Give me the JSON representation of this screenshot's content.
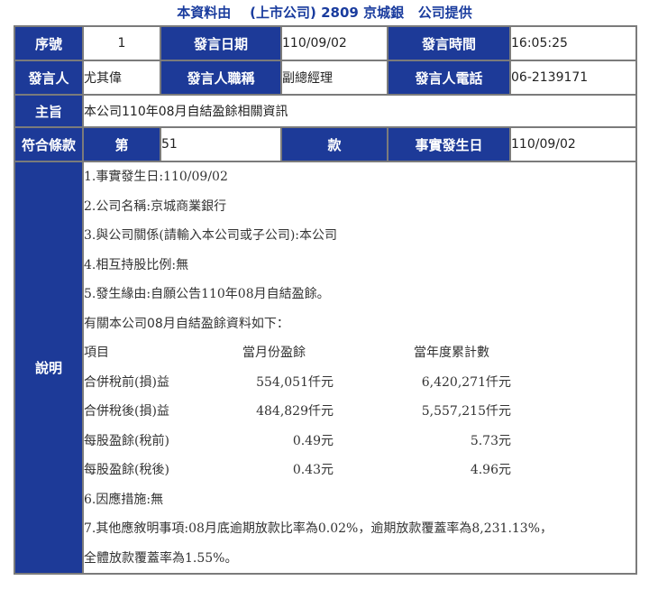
{
  "header": {
    "prefix": "本資料由",
    "company_type": "(上市公司)",
    "code": "2809",
    "company": "京城銀",
    "suffix": "公司提供"
  },
  "rows": {
    "seq_label": "序號",
    "seq_value": "1",
    "date_label": "發言日期",
    "date_value": "110/09/02",
    "time_label": "發言時間",
    "time_value": "16:05:25",
    "speaker_label": "發言人",
    "speaker_value": "尤其偉",
    "title_label": "發言人職稱",
    "title_value": "副總經理",
    "phone_label": "發言人電話",
    "phone_value": "06-2139171",
    "subject_label": "主旨",
    "subject_value": "本公司110年08月自結盈餘相關資訊",
    "clause_label": "符合條款",
    "clause_di": "第",
    "clause_value": "51",
    "clause_kuan": "款",
    "fact_date_label": "事實發生日",
    "fact_date_value": "110/09/02",
    "desc_label": "說明"
  },
  "description": {
    "l1": "1.事實發生日:110/09/02",
    "l2": "2.公司名稱:京城商業銀行",
    "l3": "3.與公司關係(請輸入本公司或子公司):本公司",
    "l4": "4.相互持股比例:無",
    "l5": "5.發生緣由:自願公告110年08月自結盈餘。",
    "intro": "有關本公司08月自結盈餘資料如下：",
    "table_headers": [
      "項目",
      "當月份盈餘",
      "當年度累計數"
    ],
    "table_rows": [
      [
        "合併稅前(損)益",
        "554,051仟元",
        "6,420,271仟元"
      ],
      [
        "合併稅後(損)益",
        "484,829仟元",
        "5,557,215仟元"
      ],
      [
        "每股盈餘(稅前)",
        "0.49元",
        "5.73元"
      ],
      [
        "每股盈餘(稅後)",
        "0.43元",
        "4.96元"
      ]
    ],
    "l6": "6.因應措施:無",
    "l7a": "7.其他應敘明事項:08月底逾期放款比率為0.02%，逾期放款覆蓋率為8,231.13%，",
    "l7b": "全體放款覆蓋率為1.55%。"
  },
  "colors": {
    "header_bg": "#1d3a98",
    "header_text": "#ffffff",
    "title_text": "#1a3c9e",
    "border": "#7b7b7b"
  }
}
